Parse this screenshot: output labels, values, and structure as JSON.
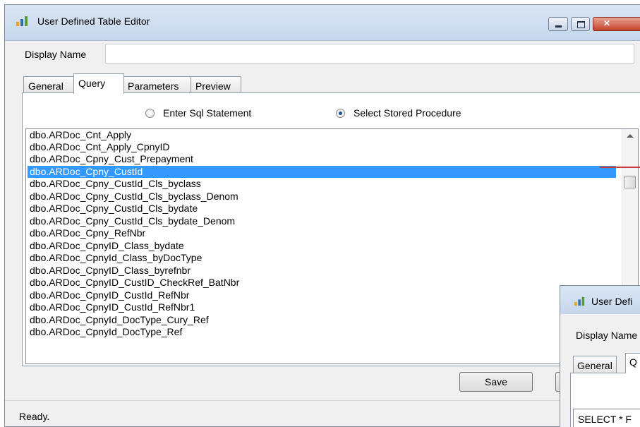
{
  "window": {
    "title": "User Defined Table Editor",
    "icon": "chart-bars-icon",
    "controls": {
      "min": "minimize-icon",
      "max": "maximize-icon",
      "close": "✕"
    }
  },
  "form": {
    "display_name_label": "Display Name",
    "display_name_value": ""
  },
  "tabs": [
    {
      "label": "General",
      "active": false
    },
    {
      "label": "Query",
      "active": true
    },
    {
      "label": "Parameters",
      "active": false
    },
    {
      "label": "Preview",
      "active": false
    }
  ],
  "query": {
    "options": [
      {
        "label": "Enter Sql Statement",
        "selected": false
      },
      {
        "label": "Select Stored Procedure",
        "selected": true
      }
    ],
    "procedures": [
      "dbo.ARDoc_Cnt_Apply",
      "dbo.ARDoc_Cnt_Apply_CpnyID",
      "dbo.ARDoc_Cpny_Cust_Prepayment",
      "dbo.ARDoc_Cpny_CustId",
      "dbo.ARDoc_Cpny_CustId_Cls_byclass",
      "dbo.ARDoc_Cpny_CustId_Cls_byclass_Denom",
      "dbo.ARDoc_Cpny_CustId_Cls_bydate",
      "dbo.ARDoc_Cpny_CustId_Cls_bydate_Denom",
      "dbo.ARDoc_Cpny_RefNbr",
      "dbo.ARDoc_CpnyID_Class_bydate",
      "dbo.ARDoc_CpnyId_Class_byDocType",
      "dbo.ARDoc_CpnyID_Class_byrefnbr",
      "dbo.ARDoc_CpnyID_CustID_CheckRef_BatNbr",
      "dbo.ARDoc_CpnyID_CustId_RefNbr",
      "dbo.ARDoc_CpnyID_CustId_RefNbr1",
      "dbo.ARDoc_CpnyId_DocType_Cury_Ref",
      "dbo.ARDoc_CpnyId_DocType_Ref"
    ],
    "selected_index": 3
  },
  "buttons": {
    "save": "Save"
  },
  "status": {
    "text": "Ready."
  },
  "second_window": {
    "title": "User Defi",
    "display_name_label": "Display Name",
    "tab_general": "General",
    "tab_query": "Q",
    "sql_text": "SELECT * F"
  }
}
